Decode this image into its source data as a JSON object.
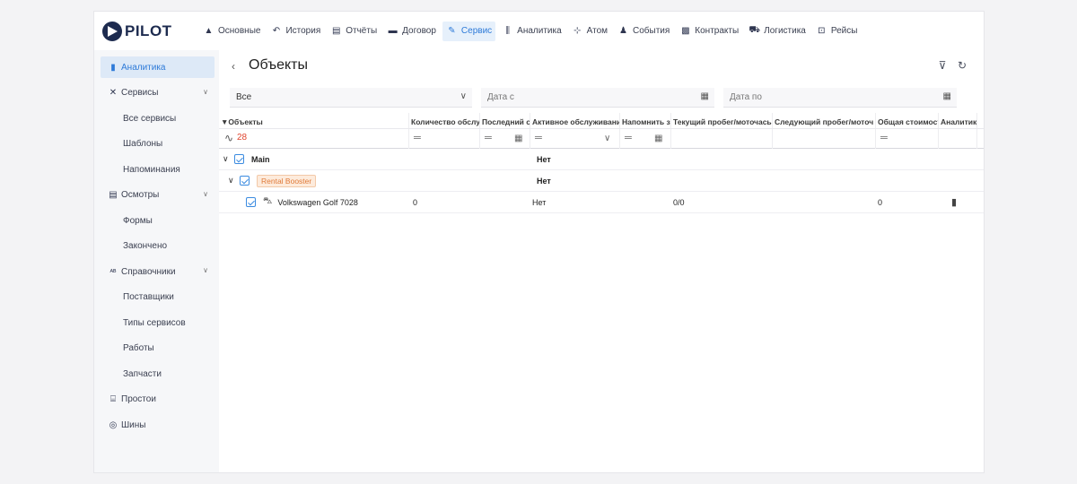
{
  "brand": {
    "name": "PILOT"
  },
  "nav": [
    {
      "label": "Основные",
      "icon": "home-icon",
      "glyph": "▲"
    },
    {
      "label": "История",
      "icon": "history-icon",
      "glyph": "↶"
    },
    {
      "label": "Отчёты",
      "icon": "report-icon",
      "glyph": "▤"
    },
    {
      "label": "Договор",
      "icon": "contract-icon",
      "glyph": "▬"
    },
    {
      "label": "Сервис",
      "icon": "wrench-icon",
      "glyph": "✎"
    },
    {
      "label": "Аналитика",
      "icon": "chart-icon",
      "glyph": "⫼"
    },
    {
      "label": "Атом",
      "icon": "atom-icon",
      "glyph": "⊹"
    },
    {
      "label": "События",
      "icon": "bell-icon",
      "glyph": "♟"
    },
    {
      "label": "Контракты",
      "icon": "briefcase-icon",
      "glyph": "▩"
    },
    {
      "label": "Логистика",
      "icon": "truck-icon",
      "glyph": "⛟"
    },
    {
      "label": "Рейсы",
      "icon": "bus-icon",
      "glyph": "⊡"
    }
  ],
  "nav_active_index": 4,
  "sidebar": {
    "items": [
      {
        "label": "Аналитика",
        "icon": "bar-chart-icon",
        "glyph": "▮"
      },
      {
        "label": "Сервисы",
        "icon": "tools-icon",
        "glyph": "✕"
      },
      {
        "label": "Все сервисы"
      },
      {
        "label": "Шаблоны"
      },
      {
        "label": "Напоминания"
      },
      {
        "label": "Осмотры",
        "icon": "document-icon",
        "glyph": "▤"
      },
      {
        "label": "Формы"
      },
      {
        "label": "Закончено"
      },
      {
        "label": "Справочники",
        "icon": "dictionary-icon",
        "glyph": "ᴬᴮ"
      },
      {
        "label": "Поставщики"
      },
      {
        "label": "Типы сервисов"
      },
      {
        "label": "Работы"
      },
      {
        "label": "Запчасти"
      },
      {
        "label": "Простои",
        "icon": "downtime-icon",
        "glyph": "⌸"
      },
      {
        "label": "Шины",
        "icon": "tire-icon",
        "glyph": "◎"
      }
    ]
  },
  "page": {
    "title": "Объекты"
  },
  "filters": {
    "type_value": "Все",
    "date_from_placeholder": "Дата с",
    "date_to_placeholder": "Дата по"
  },
  "columns": [
    "Объекты",
    "Количество обслу",
    "Последний с",
    "Активное обслуживани",
    "Напомнить з",
    "Текущий пробег/моточась",
    "Следующий пробег/моточ",
    "Общая стоимост",
    "Аналитик"
  ],
  "object_filter_value": "28",
  "rows": [
    {
      "name": "Main",
      "active": "Нет"
    },
    {
      "name": "Rental Booster",
      "active": "Нет"
    },
    {
      "name": "Volkswagen Golf 7028",
      "count": "0",
      "active": "Нет",
      "mileage": "0/0",
      "total": "0"
    }
  ]
}
